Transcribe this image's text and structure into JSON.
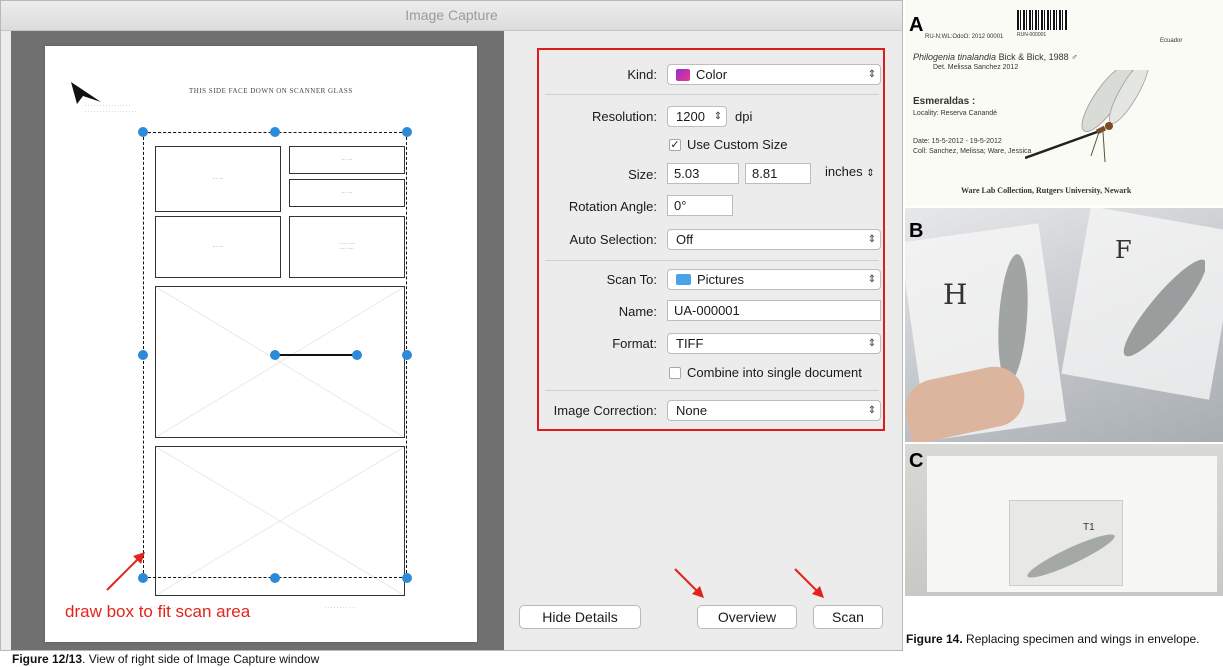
{
  "window": {
    "title": "Image Capture"
  },
  "preview": {
    "sheet_title": "THIS SIDE FACE DOWN ON SCANNER GLASS",
    "annotation": "draw box to fit scan area"
  },
  "details": {
    "kind": {
      "label": "Kind:",
      "value": "Color"
    },
    "resolution": {
      "label": "Resolution:",
      "value": "1200",
      "unit": "dpi"
    },
    "custom_size": {
      "label": "Use Custom Size",
      "checked": true
    },
    "size": {
      "label": "Size:",
      "width": "5.03",
      "height": "8.81",
      "unit": "inches"
    },
    "rotation": {
      "label": "Rotation Angle:",
      "value": "0°"
    },
    "auto_selection": {
      "label": "Auto Selection:",
      "value": "Off"
    },
    "scan_to": {
      "label": "Scan To:",
      "value": "Pictures"
    },
    "name": {
      "label": "Name:",
      "value": "UA-000001"
    },
    "format": {
      "label": "Format:",
      "value": "TIFF"
    },
    "combine": {
      "label": "Combine into single document",
      "checked": false
    },
    "image_correction": {
      "label": "Image Correction:",
      "value": "None"
    }
  },
  "buttons": {
    "hide_details": "Hide Details",
    "overview": "Overview",
    "scan": "Scan"
  },
  "caption_left": {
    "label": "Figure 12/13",
    "text": ". View of right side of Image Capture window"
  },
  "figure": {
    "panels": [
      "A",
      "B",
      "C"
    ],
    "label_card": {
      "header_left": "RU-N:WL:OdoO: 2012 00001",
      "barcode_text": "RUN-000001",
      "country": "Ecuador",
      "species": "Philogenia tinalandia",
      "author": "Bick & Bick, 1988 ♂",
      "det": "Det. Melissa Sanchez 2012",
      "province": "Esmeraldas :",
      "locality": "Locality: Reserva Canandé",
      "date": "Date: 15-5-2012 - 19-5-2012",
      "coll": "Coll: Sanchez, Melissa; Ware, Jessica",
      "collection": "Ware Lab Collection, Rutgers University, Newark"
    },
    "envelope_marks": {
      "b_left": "H",
      "b_right": "F",
      "c": "T1"
    },
    "caption_label": "Figure 14.",
    "caption_text": " Replacing specimen and wings in envelope."
  }
}
